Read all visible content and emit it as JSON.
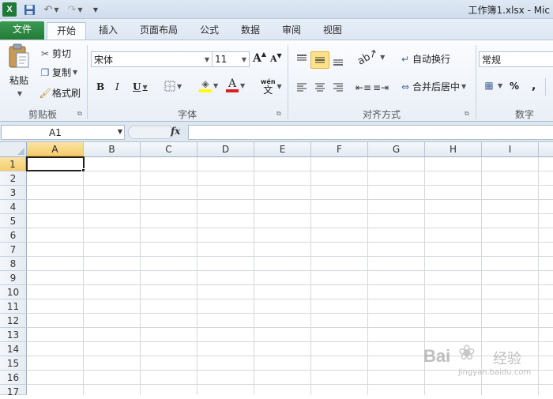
{
  "titlebar": {
    "app_icon": "X",
    "save_icon": "floppy-disk-icon",
    "window_title": "工作簿1.xlsx - Mic"
  },
  "tabs": [
    {
      "label": "文件"
    },
    {
      "label": "开始"
    },
    {
      "label": "插入"
    },
    {
      "label": "页面布局"
    },
    {
      "label": "公式"
    },
    {
      "label": "数据"
    },
    {
      "label": "审阅"
    },
    {
      "label": "视图"
    }
  ],
  "ribbon": {
    "clipboard": {
      "paste": "粘贴",
      "cut": "剪切",
      "copy": "复制",
      "format_painter": "格式刷",
      "group_label": "剪贴板"
    },
    "font": {
      "font_name": "宋体",
      "font_size": "11",
      "bold": "B",
      "italic": "I",
      "underline": "U",
      "font_color_letter": "A",
      "grow": "A",
      "shrink": "A",
      "phonetic_top": "wén",
      "phonetic_bottom": "文",
      "group_label": "字体",
      "fill_color": "#ffff00",
      "font_color": "#e02020"
    },
    "alignment": {
      "wrap_text": "自动换行",
      "merge_center": "合并后居中",
      "group_label": "对齐方式"
    },
    "number": {
      "format": "常规",
      "percent": "%",
      "comma": ",",
      "group_label": "数字"
    }
  },
  "formula_bar": {
    "name_box": "A1",
    "fx": "fx",
    "formula": ""
  },
  "grid": {
    "columns": [
      "A",
      "B",
      "C",
      "D",
      "E",
      "F",
      "G",
      "H",
      "I"
    ],
    "rows": [
      "1",
      "2",
      "3",
      "4",
      "5",
      "6",
      "7",
      "8",
      "9",
      "10",
      "11",
      "12",
      "13",
      "14",
      "15",
      "16",
      "17"
    ],
    "active_cell": "A1"
  },
  "watermark": {
    "logo": "Bai",
    "text": "经验",
    "url": "jingyan.baidu.com"
  }
}
